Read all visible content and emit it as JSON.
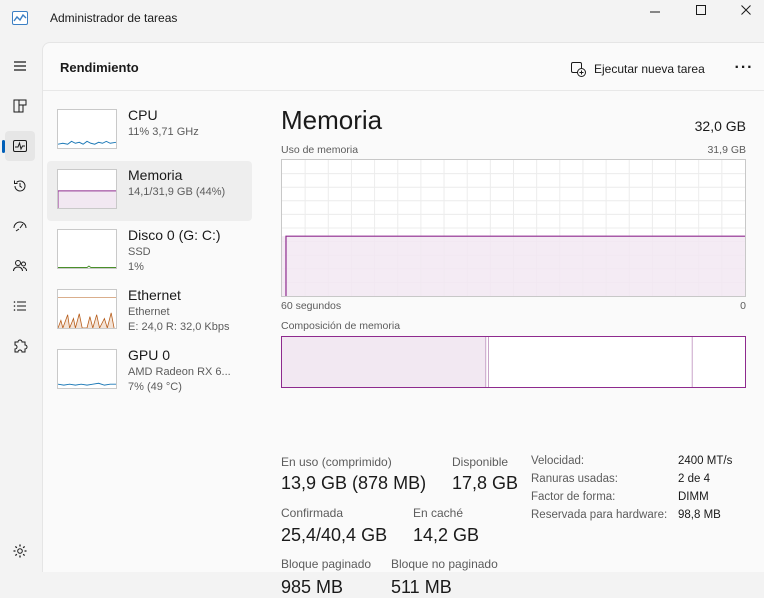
{
  "window": {
    "title": "Administrador de tareas"
  },
  "toolbar": {
    "page_title": "Rendimiento",
    "run_task": "Ejecutar nueva tarea",
    "more": "···"
  },
  "colors": {
    "accent": "#005fb8",
    "memory": "#8e2a8e",
    "memory_fill": "#f2e8f2",
    "network": "#b65c1a",
    "cpu": "#1b78b6"
  },
  "devices": [
    {
      "name": "CPU",
      "sub1": "11%  3,71 GHz",
      "sub2": "",
      "sub3": ""
    },
    {
      "name": "Memoria",
      "sub1": "14,1/31,9 GB (44%)",
      "sub2": "",
      "sub3": ""
    },
    {
      "name": "Disco 0 (G: C:)",
      "sub1": "SSD",
      "sub2": "1%",
      "sub3": ""
    },
    {
      "name": "Ethernet",
      "sub1": "Ethernet",
      "sub2": "E: 24,0  R: 32,0 Kbps",
      "sub3": ""
    },
    {
      "name": "GPU 0",
      "sub1": "AMD Radeon RX 6...",
      "sub2": "7%  (49 °C)",
      "sub3": ""
    }
  ],
  "memory": {
    "title": "Memoria",
    "total": "32,0 GB",
    "usage_label": "Uso de memoria",
    "usage_max": "31,9 GB",
    "time_label": "60 segundos",
    "zero_label": "0",
    "usage_fraction": 0.44,
    "composition_label": "Composición de memoria",
    "composition": {
      "in_use_fraction": 0.44,
      "modified_fraction": 0.006,
      "standby_fraction": 0.44,
      "free_fraction": 0.114
    }
  },
  "stats": {
    "in_use_label": "En uso (comprimido)",
    "in_use_value": "13,9 GB (878 MB)",
    "available_label": "Disponible",
    "available_value": "17,8 GB",
    "committed_label": "Confirmada",
    "committed_value": "25,4/40,4 GB",
    "cached_label": "En caché",
    "cached_value": "14,2 GB",
    "paged_label": "Bloque paginado",
    "paged_value": "985 MB",
    "nonpaged_label": "Bloque no paginado",
    "nonpaged_value": "511 MB"
  },
  "specs": [
    {
      "key": "Velocidad:",
      "value": "2400 MT/s"
    },
    {
      "key": "Ranuras usadas:",
      "value": "2 de 4"
    },
    {
      "key": "Factor de forma:",
      "value": "DIMM"
    },
    {
      "key": "Reservada para hardware:",
      "value": "98,8 MB"
    }
  ]
}
